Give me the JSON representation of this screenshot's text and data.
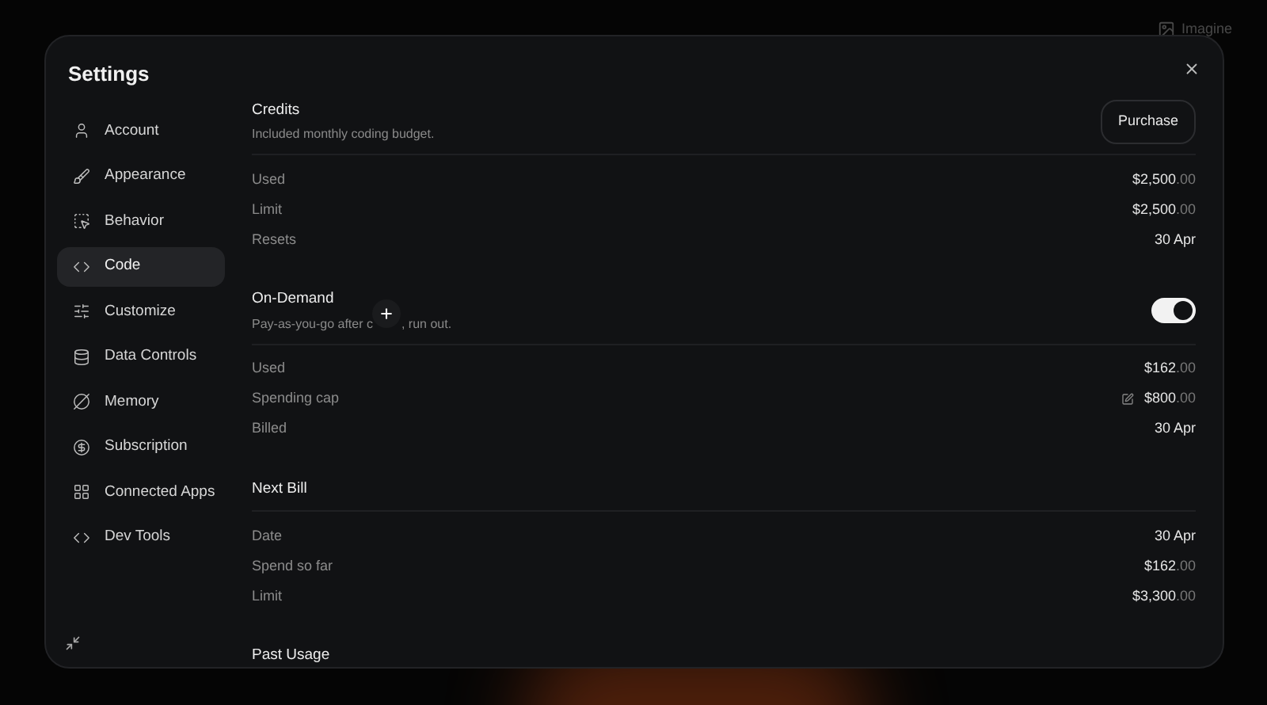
{
  "background": {
    "label": "Imagine"
  },
  "dialog": {
    "title": "Settings"
  },
  "sidebar": {
    "items": [
      {
        "label": "Account",
        "selected": false
      },
      {
        "label": "Appearance",
        "selected": false
      },
      {
        "label": "Behavior",
        "selected": false
      },
      {
        "label": "Code",
        "selected": true
      },
      {
        "label": "Customize",
        "selected": false
      },
      {
        "label": "Data Controls",
        "selected": false
      },
      {
        "label": "Memory",
        "selected": false
      },
      {
        "label": "Subscription",
        "selected": false
      },
      {
        "label": "Connected Apps",
        "selected": false
      },
      {
        "label": "Dev Tools",
        "selected": false
      }
    ]
  },
  "sections": [
    {
      "title": "Credits",
      "subtitle_parts": [
        "Included monthly coding budget."
      ],
      "action": {
        "kind": "button",
        "label": "Purchase"
      },
      "rows": [
        {
          "label": "Used",
          "value": "$2,500",
          "cents": ".00"
        },
        {
          "label": "Limit",
          "value": "$2,500",
          "cents": ".00"
        },
        {
          "label": "Resets",
          "value": "30 Apr"
        }
      ]
    },
    {
      "title": "On-Demand",
      "subtitle_parts": [
        "Pay-as-you-go after c",
        ", run out."
      ],
      "action": {
        "kind": "toggle",
        "on": true
      },
      "rows": [
        {
          "label": "Used",
          "value": "$162",
          "cents": ".00"
        },
        {
          "label": "Spending cap",
          "value": "$800",
          "cents": ".00",
          "editable": true
        },
        {
          "label": "Billed",
          "value": "30 Apr"
        }
      ]
    },
    {
      "title": "Next Bill",
      "rows": [
        {
          "label": "Date",
          "value": "30 Apr"
        },
        {
          "label": "Spend so far",
          "value": "$162",
          "cents": ".00"
        },
        {
          "label": "Limit",
          "value": "$3,300",
          "cents": ".00"
        }
      ]
    },
    {
      "title": "Past Usage"
    }
  ]
}
